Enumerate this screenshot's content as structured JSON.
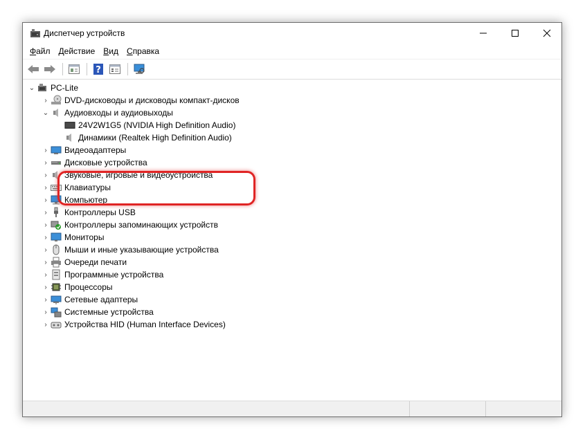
{
  "window": {
    "title": "Диспетчер устройств",
    "controls": [
      "minimize-icon",
      "maximize-icon",
      "close-icon"
    ]
  },
  "menu": [
    {
      "label": "Файл",
      "access_key": "Ф",
      "rest": "айл"
    },
    {
      "label": "Действие",
      "access_key": "Д",
      "rest": "ействие"
    },
    {
      "label": "Вид",
      "access_key": "В",
      "rest": "ид"
    },
    {
      "label": "Справка",
      "access_key": "С",
      "rest": "правка"
    }
  ],
  "toolbar": [
    "back-arrow-icon",
    "forward-arrow-icon",
    "properties-icon",
    "help-icon",
    "view-icon",
    "scan-hardware-icon"
  ],
  "tree": {
    "root": "PC-Lite",
    "categories": [
      {
        "label": "DVD-дисководы и дисководы компакт-дисков",
        "icon": "dvd-drive-icon",
        "expanded": false
      },
      {
        "label": "Аудиовходы и аудиовыходы",
        "icon": "audio-io-icon",
        "expanded": true,
        "children": [
          {
            "label": "24V2W1G5 (NVIDIA High Definition Audio)",
            "icon": "monitor-audio-icon"
          },
          {
            "label": "Динамики (Realtek High Definition Audio)",
            "icon": "speaker-icon"
          }
        ]
      },
      {
        "label": "Видеоадаптеры",
        "icon": "display-adapter-icon",
        "expanded": false
      },
      {
        "label": "Дисковые устройства",
        "icon": "disk-drive-icon",
        "expanded": false
      },
      {
        "label": "Звуковые, игровые и видеоустройства",
        "icon": "sound-icon",
        "expanded": false
      },
      {
        "label": "Клавиатуры",
        "icon": "keyboard-icon",
        "expanded": false
      },
      {
        "label": "Компьютер",
        "icon": "computer-icon",
        "expanded": false
      },
      {
        "label": "Контроллеры USB",
        "icon": "usb-icon",
        "expanded": false
      },
      {
        "label": "Контроллеры запоминающих устройств",
        "icon": "storage-controller-icon",
        "expanded": false
      },
      {
        "label": "Мониторы",
        "icon": "monitor-icon",
        "expanded": false
      },
      {
        "label": "Мыши и иные указывающие устройства",
        "icon": "mouse-icon",
        "expanded": false
      },
      {
        "label": "Очереди печати",
        "icon": "printer-icon",
        "expanded": false
      },
      {
        "label": "Программные устройства",
        "icon": "software-device-icon",
        "expanded": false
      },
      {
        "label": "Процессоры",
        "icon": "processor-icon",
        "expanded": false
      },
      {
        "label": "Сетевые адаптеры",
        "icon": "network-adapter-icon",
        "expanded": false
      },
      {
        "label": "Системные устройства",
        "icon": "system-device-icon",
        "expanded": false
      },
      {
        "label": "Устройства HID (Human Interface Devices)",
        "icon": "hid-icon",
        "expanded": false
      }
    ]
  },
  "colors": {
    "highlight": "#e02424",
    "border": "#6d6d6d"
  }
}
